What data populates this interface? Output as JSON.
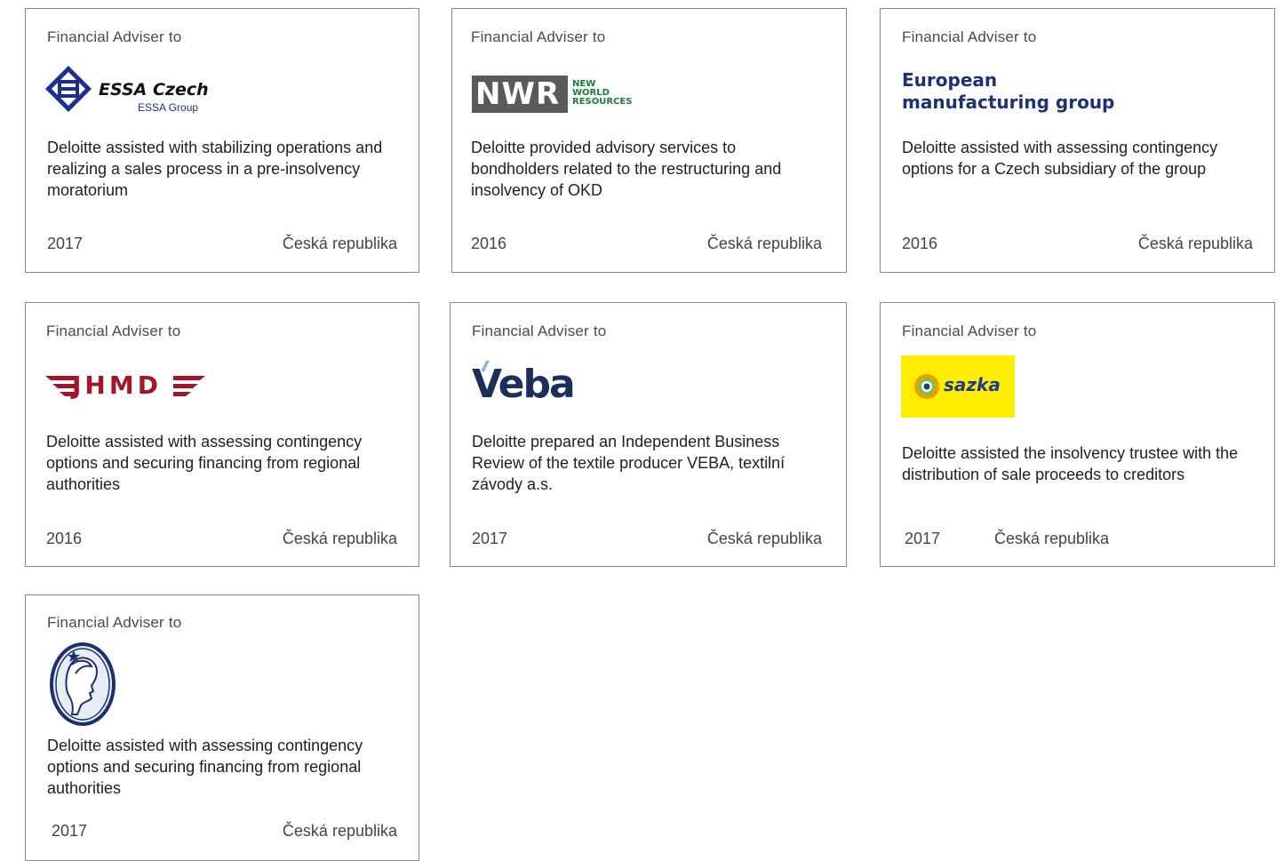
{
  "cards": [
    {
      "label": "Financial Adviser to",
      "logo_name": "ESSA Czech",
      "logo_sub": "ESSA Group",
      "description": "Deloitte assisted with stabilizing operations and realizing a sales process in a pre-insolvency moratorium",
      "year": "2017",
      "country": "Česká republika"
    },
    {
      "label": "Financial Adviser to",
      "logo_name": "NWR",
      "logo_sub_lines": [
        "NEW",
        "WORLD",
        "RESOURCES"
      ],
      "description": "Deloitte provided advisory services to bondholders related to the restructuring and insolvency of OKD",
      "year": "2016",
      "country": "Česká republika"
    },
    {
      "label": "Financial Adviser to",
      "logo_lines": [
        "European",
        "manufacturing group"
      ],
      "description": "Deloitte assisted with assessing contingency options for a Czech subsidiary of the group",
      "year": "2016",
      "country": "Česká republika"
    },
    {
      "label": "Financial Adviser to",
      "logo_name": "JHMD",
      "description": "Deloitte assisted with assessing contingency options and securing financing from regional authorities",
      "year": "2016",
      "country": "Česká republika"
    },
    {
      "label": "Financial Adviser to",
      "logo_name": "Veba",
      "description": "Deloitte prepared an Independent Business Review of the textile producer VEBA, textilní závody a.s.",
      "year": "2017",
      "country": "Česká republika"
    },
    {
      "label": "Financial Adviser to",
      "logo_name": "sazka",
      "description": "Deloitte assisted the insolvency trustee with the distribution of sale proceeds to creditors",
      "year": "2017",
      "country": "Česká republika"
    },
    {
      "label": "Financial Adviser to",
      "logo_name": "",
      "description": "Deloitte assisted with assessing contingency options and securing financing from regional authorities",
      "year": "2017",
      "country": "Česká republika"
    }
  ],
  "colors": {
    "border": "#8a8a8a",
    "essa_blue": "#1b2f8f",
    "nwr_gray": "#5a5a5a",
    "nwr_green": "#1e7a3a",
    "emg_navy": "#1f2f78",
    "jhmd_red": "#a3162a",
    "veba_navy": "#1c2f5c",
    "sazka_yellow": "#ffee00"
  }
}
